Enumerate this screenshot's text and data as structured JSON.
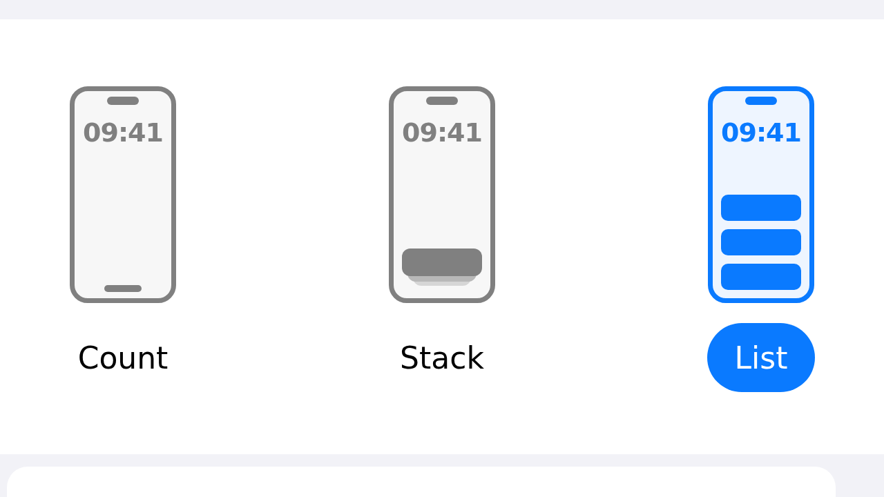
{
  "styles": [
    {
      "label": "Count",
      "kind": "count",
      "time": "09:41",
      "selected": false
    },
    {
      "label": "Stack",
      "kind": "stack",
      "time": "09:41",
      "selected": false
    },
    {
      "label": "List",
      "kind": "list",
      "time": "09:41",
      "selected": true
    }
  ]
}
